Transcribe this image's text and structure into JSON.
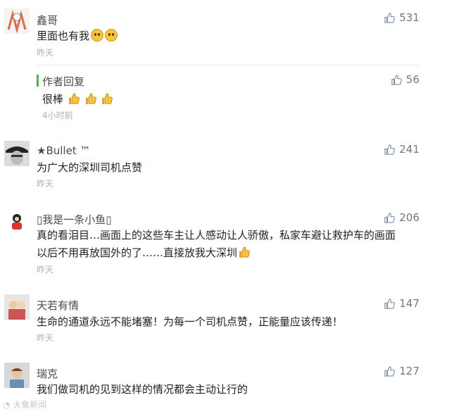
{
  "comments": [
    {
      "name": "鑫哥",
      "text": "里面也有我",
      "time": "昨天",
      "likes": "531"
    },
    {
      "name": "★Bullet ™",
      "text": "为广大的深圳司机点赞",
      "time": "昨天",
      "likes": "241"
    },
    {
      "name": "▯我是一条小鱼▯",
      "text_line1": "真的看泪目…画面上的这些车主让人感动让人骄傲，私家车避让救护车的画面",
      "text_line2": "以后不用再放国外的了……直接放我大深圳",
      "time": "昨天",
      "likes": "206"
    },
    {
      "name": "天若有情",
      "text": "生命的通道永远不能堵塞！为每一个司机点赞，正能量应该传递！",
      "time": "昨天",
      "likes": "147"
    },
    {
      "name": "瑞克",
      "text": "我们做司机的见到这样的情况都会主动让行的",
      "likes": "127"
    }
  ],
  "reply": {
    "name": "作者回复",
    "text": "很棒",
    "time": "4小时前",
    "likes": "56"
  },
  "watermark": "大象新闻",
  "icons": {
    "like": "thumb-up-icon",
    "smile": "smile-emoji-icon",
    "thumb_emoji": "thumbs-up-emoji-icon"
  },
  "colors": {
    "reply_bar": "#46b34b",
    "time": "#b0b0b0"
  }
}
